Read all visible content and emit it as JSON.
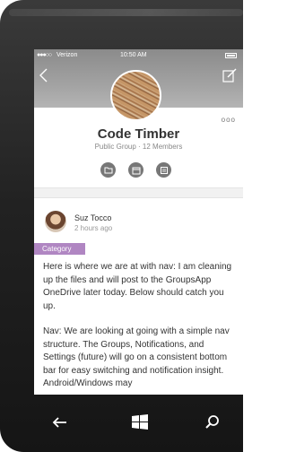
{
  "status_bar": {
    "signal": "●●●○○",
    "carrier": "Verizon",
    "time": "10:50 AM"
  },
  "group": {
    "name": "Code Timber",
    "meta": "Public Group · 12 Members"
  },
  "more_label": "ooo",
  "post": {
    "author": "Suz Tocco",
    "time": "2 hours ago",
    "category": "Category",
    "paragraph1": "Here is where we are at with nav: I am cleaning up the files and will post to the GroupsApp OneDrive later today. Below should catch you up.",
    "paragraph2": "Nav: We are looking at going with a simple nav structure. The Groups, Notifications, and Settings (future) will go on a consistent bottom bar for easy switching and notification insight. Android/Windows may"
  },
  "colors": {
    "category_bg": "#b086c2",
    "header_bg": "#9a9a9a",
    "action_icon_bg": "#777777"
  },
  "icons": [
    "back-arrow-icon",
    "edit-icon",
    "folder-icon",
    "calendar-icon",
    "notebook-icon",
    "windows-logo-icon",
    "search-icon"
  ]
}
